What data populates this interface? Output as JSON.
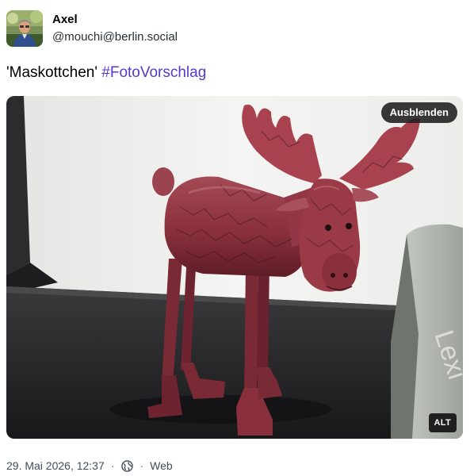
{
  "author": {
    "display_name": "Axel",
    "handle": "@mouchi@berlin.social"
  },
  "status": {
    "text": "'Maskottchen' ",
    "hashtag": "#FotoVorschlag",
    "hashtag_color": "#563acc"
  },
  "media": {
    "hide_label": "Ausblenden",
    "alt_label": "ALT"
  },
  "meta": {
    "timestamp": "29. Mai 2026, 12:37",
    "separator": "·",
    "visibility_icon": "globe-icon",
    "application": "Web"
  }
}
